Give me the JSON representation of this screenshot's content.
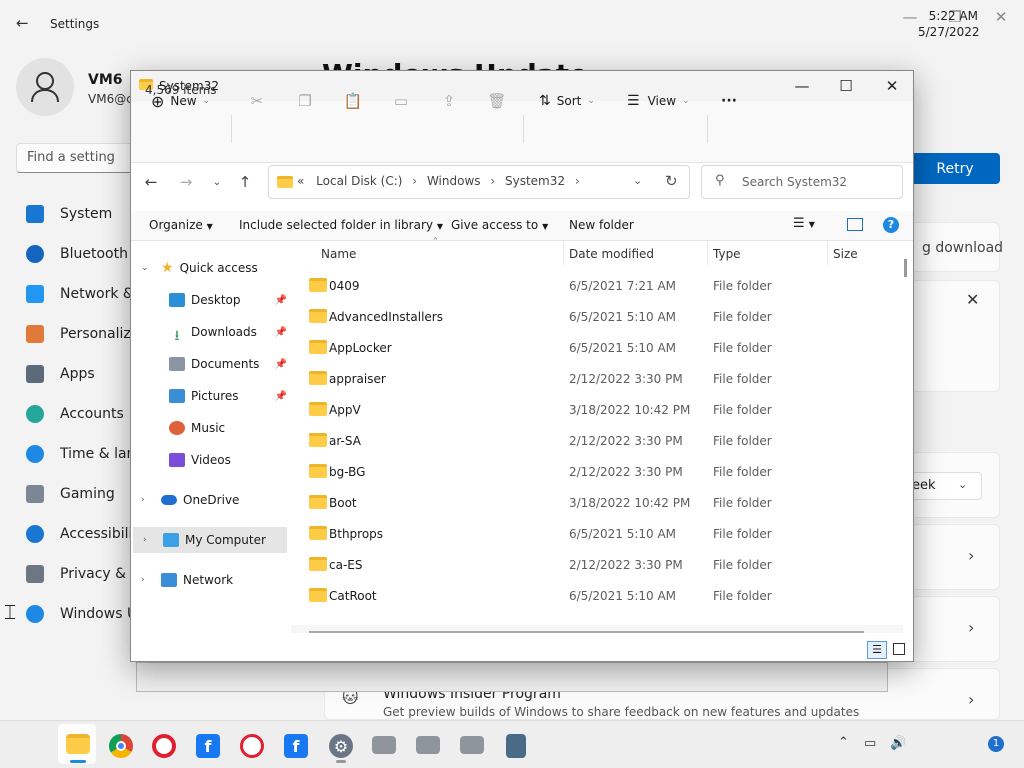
{
  "settings": {
    "title": "Settings",
    "user_name": "VM6",
    "user_email": "VM6@c",
    "search_placeholder": "Find a setting",
    "nav": [
      "System",
      "Bluetooth &",
      "Network &",
      "Personaliza",
      "Apps",
      "Accounts",
      "Time & lang",
      "Gaming",
      "Accessibili",
      "Privacy & s",
      "Windows U"
    ],
    "heading": "Windows Update",
    "retry_label": "Retry",
    "download_text": "g download",
    "week_text": "eek",
    "insider_title": "Windows Insider Program",
    "insider_desc": "Get preview builds of Windows to share feedback on new features and updates"
  },
  "explorer": {
    "title": "System32",
    "toolbar": {
      "new": "New",
      "sort": "Sort",
      "view": "View",
      "more": "···"
    },
    "address": {
      "prefix": "«",
      "crumbs": [
        "Local Disk (C:)",
        "Windows",
        "System32"
      ]
    },
    "search_placeholder": "Search System32",
    "ribbon": {
      "organize": "Organize",
      "include": "Include selected folder in library",
      "give_access": "Give access to",
      "new_folder": "New folder"
    },
    "columns": {
      "name": "Name",
      "date": "Date modified",
      "type": "Type",
      "size": "Size"
    },
    "tree": [
      {
        "label": "Quick access"
      },
      {
        "label": "Desktop"
      },
      {
        "label": "Downloads"
      },
      {
        "label": "Documents"
      },
      {
        "label": "Pictures"
      },
      {
        "label": "Music"
      },
      {
        "label": "Videos"
      },
      {
        "label": "OneDrive"
      },
      {
        "label": "My Computer"
      },
      {
        "label": "Network"
      }
    ],
    "rows": [
      {
        "name": "0409",
        "date": "6/5/2021 7:21 AM",
        "type": "File folder"
      },
      {
        "name": "AdvancedInstallers",
        "date": "6/5/2021 5:10 AM",
        "type": "File folder"
      },
      {
        "name": "AppLocker",
        "date": "6/5/2021 5:10 AM",
        "type": "File folder"
      },
      {
        "name": "appraiser",
        "date": "2/12/2022 3:30 PM",
        "type": "File folder"
      },
      {
        "name": "AppV",
        "date": "3/18/2022 10:42 PM",
        "type": "File folder"
      },
      {
        "name": "ar-SA",
        "date": "2/12/2022 3:30 PM",
        "type": "File folder"
      },
      {
        "name": "bg-BG",
        "date": "2/12/2022 3:30 PM",
        "type": "File folder"
      },
      {
        "name": "Boot",
        "date": "3/18/2022 10:42 PM",
        "type": "File folder"
      },
      {
        "name": "Bthprops",
        "date": "6/5/2021 5:10 AM",
        "type": "File folder"
      },
      {
        "name": "ca-ES",
        "date": "2/12/2022 3:30 PM",
        "type": "File folder"
      },
      {
        "name": "CatRoot",
        "date": "6/5/2021 5:10 AM",
        "type": "File folder"
      }
    ],
    "status": "4,569 items"
  },
  "taskbar": {
    "time": "5:22 AM",
    "date": "5/27/2022",
    "notification_count": "1"
  }
}
